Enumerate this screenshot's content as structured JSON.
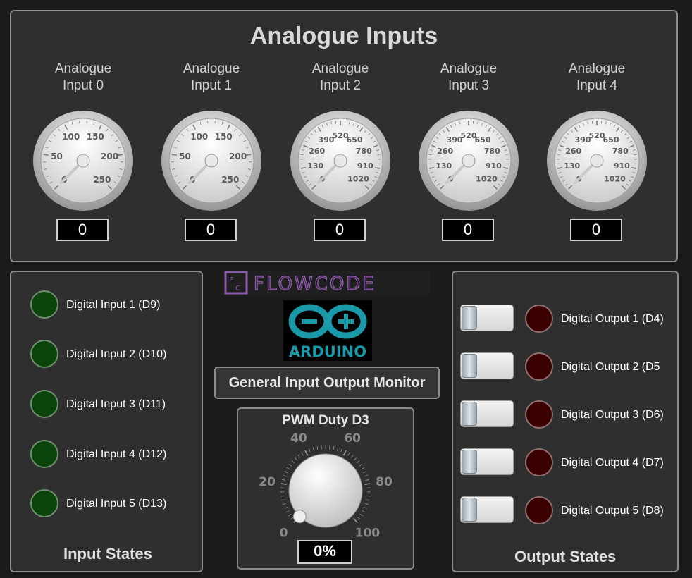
{
  "analogue": {
    "title": "Analogue Inputs",
    "gauges": [
      {
        "label_line1": "Analogue",
        "label_line2": "Input 0",
        "value": "0",
        "ticks": [
          "0",
          "50",
          "100",
          "150",
          "200",
          "250"
        ]
      },
      {
        "label_line1": "Analogue",
        "label_line2": "Input 1",
        "value": "0",
        "ticks": [
          "0",
          "50",
          "100",
          "150",
          "200",
          "250"
        ]
      },
      {
        "label_line1": "Analogue",
        "label_line2": "Input 2",
        "value": "0",
        "ticks": [
          "0",
          "130",
          "260",
          "390",
          "520",
          "650",
          "780",
          "910",
          "1020"
        ]
      },
      {
        "label_line1": "Analogue",
        "label_line2": "Input 3",
        "value": "0",
        "ticks": [
          "0",
          "130",
          "260",
          "390",
          "520",
          "650",
          "780",
          "910",
          "1020"
        ]
      },
      {
        "label_line1": "Analogue",
        "label_line2": "Input 4",
        "value": "0",
        "ticks": [
          "0",
          "130",
          "260",
          "390",
          "520",
          "650",
          "780",
          "910",
          "1020"
        ]
      }
    ]
  },
  "inputs": {
    "items": [
      {
        "label": "Digital Input 1 (D9)"
      },
      {
        "label": "Digital Input 2 (D10)"
      },
      {
        "label": "Digital Input 3 (D11)"
      },
      {
        "label": "Digital Input 4 (D12)"
      },
      {
        "label": "Digital Input 5 (D13)"
      }
    ],
    "footer": "Input States"
  },
  "outputs": {
    "items": [
      {
        "label": "Digital Output 1 (D4)"
      },
      {
        "label": "Digital Output 2 (D5"
      },
      {
        "label": "Digital Output 3 (D6)"
      },
      {
        "label": "Digital Output 4 (D7)"
      },
      {
        "label": "Digital Output 5 (D8)"
      }
    ],
    "footer": "Output States"
  },
  "logos": {
    "flowcode": "FLOWCODE",
    "arduino": "ARDUINO"
  },
  "monitor_button": "General Input Output Monitor",
  "pwm": {
    "title": "PWM Duty D3",
    "value": "0%",
    "scale": [
      "0",
      "20",
      "40",
      "60",
      "80",
      "100"
    ]
  },
  "colors": {
    "panel": "#2f2f2f",
    "border": "#8c8c8c",
    "input_led": "#0a440a",
    "output_led": "#3a0000",
    "flowcode": "#8a5aa8",
    "arduino": "#1a9aa8"
  }
}
